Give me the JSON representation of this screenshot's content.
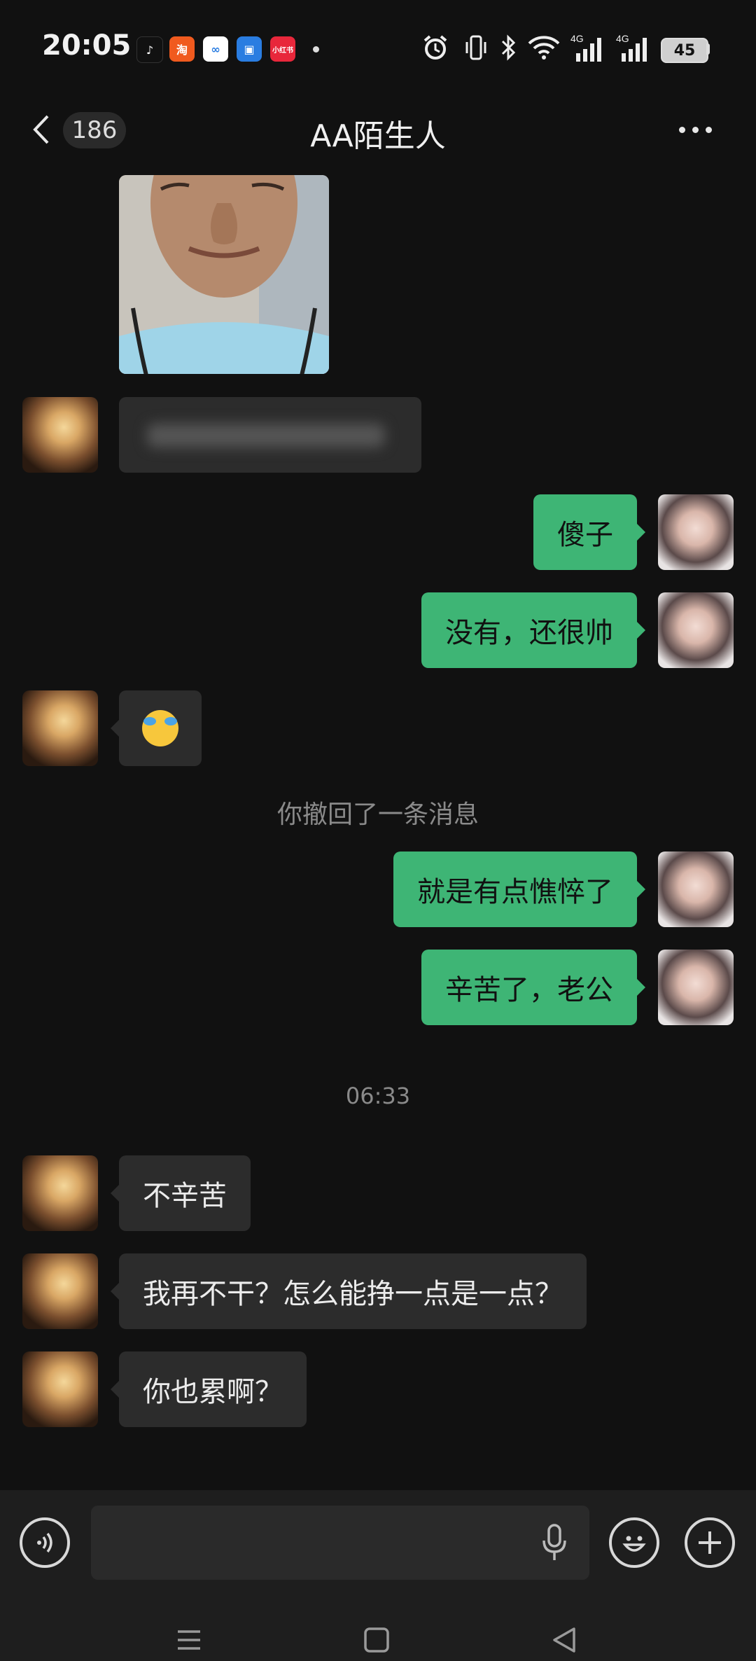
{
  "status_bar": {
    "time": "20:05",
    "app_icons": [
      {
        "name": "tiktok-icon",
        "glyph": "♪",
        "color": "#111111"
      },
      {
        "name": "taobao-icon",
        "glyph": "淘",
        "color": "#f05a1e"
      },
      {
        "name": "baidu-netdisk-icon",
        "glyph": "∞",
        "color": "#ffffff"
      },
      {
        "name": "blue-bag-icon",
        "glyph": "▣",
        "color": "#2a7de1"
      },
      {
        "name": "xiaohongshu-icon",
        "glyph": "小红书",
        "color": "#e8273b"
      }
    ],
    "signal_labels": [
      "4G",
      "4G"
    ],
    "battery": "45"
  },
  "header": {
    "unread_count": "186",
    "title": "AA陌生人"
  },
  "messages": {
    "out_1": "傻子",
    "out_2": "没有，还很帅",
    "recall_notice": "你撤回了一条消息",
    "out_3": "就是有点憔悴了",
    "out_4": "辛苦了，老公",
    "timestamp": "06:33",
    "in_1": "不辛苦",
    "in_2": "我再不干？怎么能挣一点是一点？",
    "in_3": "你也累啊？"
  },
  "input_bar": {
    "value": ""
  },
  "colors": {
    "background": "#111111",
    "incoming_bubble": "#2c2c2c",
    "outgoing_bubble": "#3eb575"
  }
}
